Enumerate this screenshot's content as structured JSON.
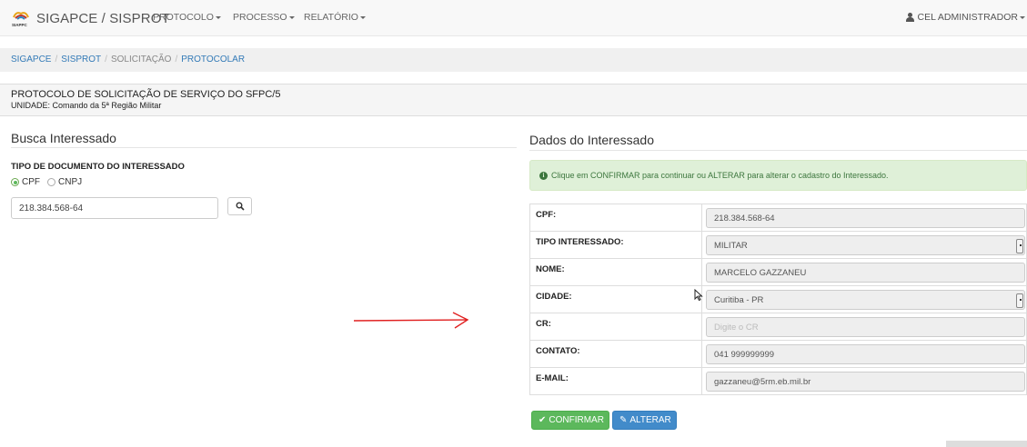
{
  "navbar": {
    "brand": "SIGAPCE / SISPROT",
    "brand_logo_text": "SIAPPC",
    "menus": [
      "PROTOCOLO",
      "PROCESSO",
      "RELATÓRIO"
    ],
    "user": "CEL ADMINISTRADOR"
  },
  "breadcrumb": {
    "items": [
      "SIGAPCE",
      "SISPROT",
      "SOLICITAÇÃO",
      "PROTOCOLAR"
    ]
  },
  "page": {
    "title": "PROTOCOLO DE SOLICITAÇÃO DE SERVIÇO DO SFPC/5",
    "unit": "UNIDADE: Comando da 5ª Região Militar"
  },
  "busca": {
    "title": "Busca Interessado",
    "doc_type_label": "TIPO DE DOCUMENTO DO INTERESSADO",
    "options": [
      "CPF",
      "CNPJ"
    ],
    "selected_option": "CPF",
    "search_value": "218.384.568-64"
  },
  "dados": {
    "title": "Dados do Interessado",
    "alert": "Clique em CONFIRMAR para continuar ou ALTERAR para alterar o cadastro do Interessado.",
    "rows": [
      {
        "label": "CPF:",
        "value": "218.384.568-64"
      },
      {
        "label": "TIPO INTERESSADO:",
        "value": "MILITAR"
      },
      {
        "label": "NOME:",
        "value": "MARCELO GAZZANEU"
      },
      {
        "label": "CIDADE:",
        "value": "Curitiba - PR"
      },
      {
        "label": "CR:",
        "placeholder": "Digite o CR"
      },
      {
        "label": "CONTATO:",
        "value": "041 999999999"
      },
      {
        "label": "E-MAIL:",
        "value": "gazzaneu@5rm.eb.mil.br"
      }
    ],
    "confirm_label": "CONFIRMAR",
    "alter_label": "ALTERAR"
  },
  "colors": {
    "success": "#5cb85c",
    "primary": "#428bca",
    "link": "#337ab7",
    "alert_bg": "#dff0d8",
    "annotation_arrow": "#e02020"
  }
}
